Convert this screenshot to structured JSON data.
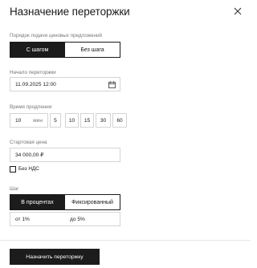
{
  "header": {
    "title": "Назначение переторжки",
    "close_icon": "close-icon"
  },
  "bid_order": {
    "label": "Порядок подачи ценовых предложений",
    "options": [
      "С шагом",
      "Без шага"
    ],
    "selected": "С шагом"
  },
  "start": {
    "label": "Начало переторжки",
    "value": "11.09.2025 12:00",
    "icon": "calendar-icon"
  },
  "extension": {
    "label": "Время продления",
    "value": "10",
    "unit": "мин",
    "presets": [
      "5",
      "10",
      "15",
      "30",
      "60"
    ]
  },
  "start_price": {
    "label": "Стартовая цена",
    "value": "34 000,00 ₽"
  },
  "vat": {
    "label": "Без НДС",
    "checked": false
  },
  "step": {
    "label": "Шаг",
    "options": [
      "В процентах",
      "Фиксированный"
    ],
    "selected": "В процентах",
    "from": "от 1%",
    "to": "до 5%"
  },
  "footer": {
    "submit_label": "Назначить переторжку"
  },
  "colors": {
    "accent": "#1c1c1c",
    "border": "#d4d4d4",
    "label": "#777777"
  }
}
